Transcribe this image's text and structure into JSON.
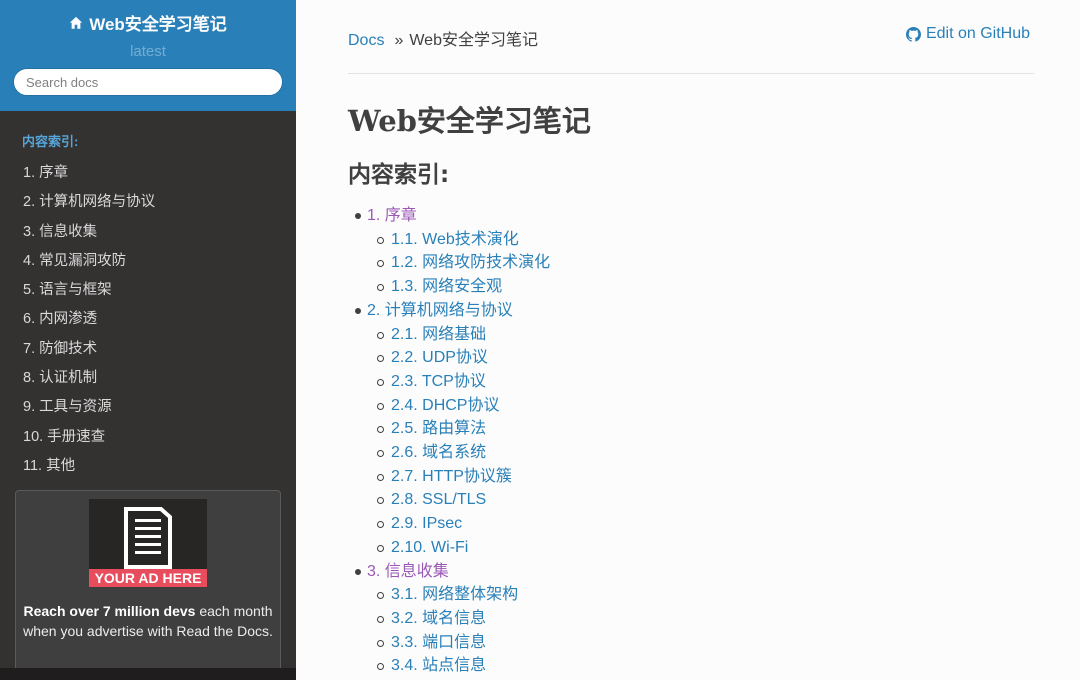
{
  "sidebar": {
    "brand": "Web安全学习笔记",
    "version": "latest",
    "search_placeholder": "Search docs",
    "caption": "内容索引:",
    "items": [
      "1. 序章",
      "2. 计算机网络与协议",
      "3. 信息收集",
      "4. 常见漏洞攻防",
      "5. 语言与框架",
      "6. 内网渗透",
      "7. 防御技术",
      "8. 认证机制",
      "9. 工具与资源",
      "10. 手册速查",
      "11. 其他"
    ],
    "ad": {
      "banner": "YOUR AD HERE",
      "text_bold": "Reach over 7 million devs",
      "text_rest": " each month when you advertise with Read the Docs."
    }
  },
  "breadcrumb": {
    "home": "Docs",
    "separator": "»",
    "current": "Web安全学习笔记"
  },
  "edit_link": "Edit on GitHub",
  "page": {
    "title": "Web安全学习笔记",
    "subtitle": "内容索引:"
  },
  "toc": {
    "sections": [
      {
        "label": "1. 序章",
        "children": [
          "1.1. Web技术演化",
          "1.2. 网络攻防技术演化",
          "1.3. 网络安全观"
        ]
      },
      {
        "label": "2. 计算机网络与协议",
        "children": [
          "2.1. 网络基础",
          "2.2. UDP协议",
          "2.3. TCP协议",
          "2.4. DHCP协议",
          "2.5. 路由算法",
          "2.6. 域名系统",
          "2.7. HTTP协议簇",
          "2.8. SSL/TLS",
          "2.9. IPsec",
          "2.10. Wi-Fi"
        ]
      },
      {
        "label": "3. 信息收集",
        "children": [
          "3.1. 网络整体架构",
          "3.2. 域名信息",
          "3.3. 端口信息",
          "3.4. 站点信息"
        ]
      }
    ]
  },
  "colors": {
    "sidebar_top": "#2980b9",
    "sidebar_bg": "#343131",
    "link": "#2980b9",
    "visited": "#9b59b6",
    "ad_banner": "#e84d5e"
  }
}
